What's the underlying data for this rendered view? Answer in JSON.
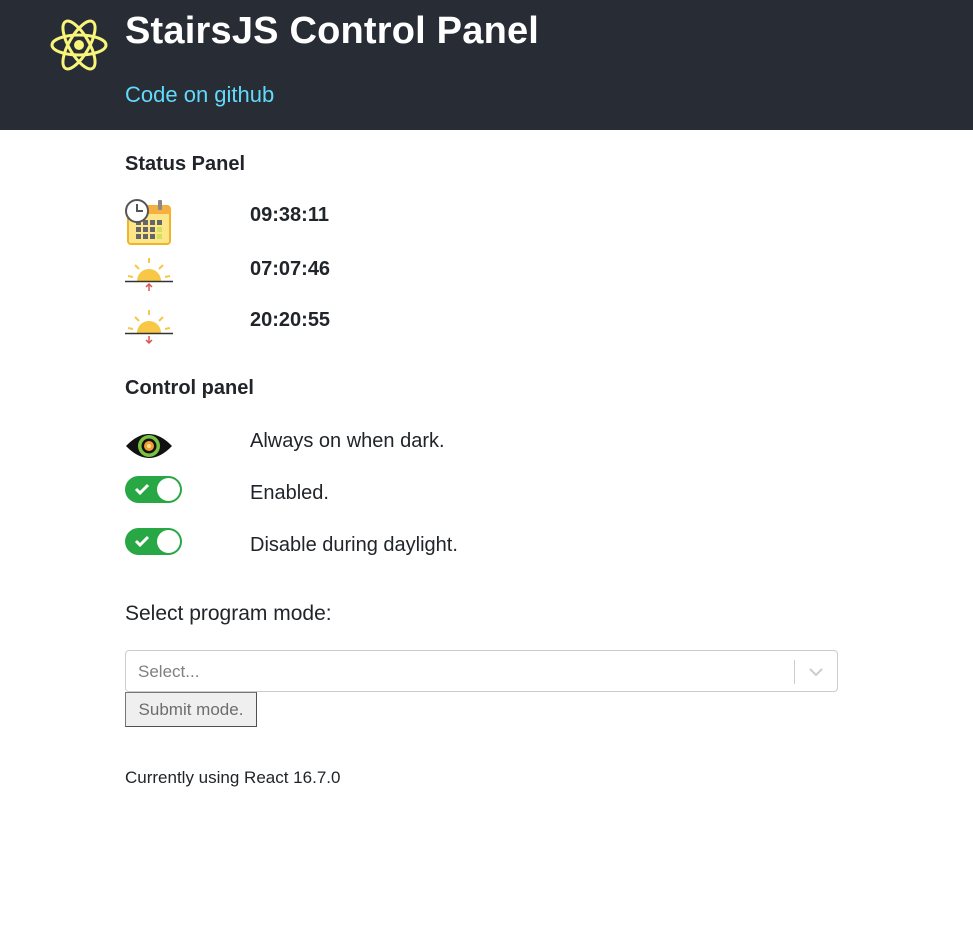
{
  "header": {
    "title": "StairsJS Control Panel",
    "github_link": "Code on github",
    "logo_icon": "react-atom-icon",
    "accent_color": "#61dafb",
    "background_color": "#282c34"
  },
  "status": {
    "heading": "Status Panel",
    "items": [
      {
        "icon": "clock-calendar-icon",
        "value": "09:38:11"
      },
      {
        "icon": "sunrise-icon",
        "value": "07:07:46"
      },
      {
        "icon": "sunset-icon",
        "value": "20:20:55"
      }
    ]
  },
  "control": {
    "heading": "Control panel",
    "items": [
      {
        "icon": "eye-icon",
        "label": "Always on when dark."
      },
      {
        "icon": "toggle-switch",
        "label": "Enabled.",
        "checked": true
      },
      {
        "icon": "toggle-switch",
        "label": "Disable during daylight.",
        "checked": true
      }
    ],
    "toggle_color": "#28a745"
  },
  "mode": {
    "label": "Select program mode:",
    "placeholder": "Select...",
    "submit_label": "Submit mode."
  },
  "footer": {
    "text": "Currently using React 16.7.0"
  }
}
